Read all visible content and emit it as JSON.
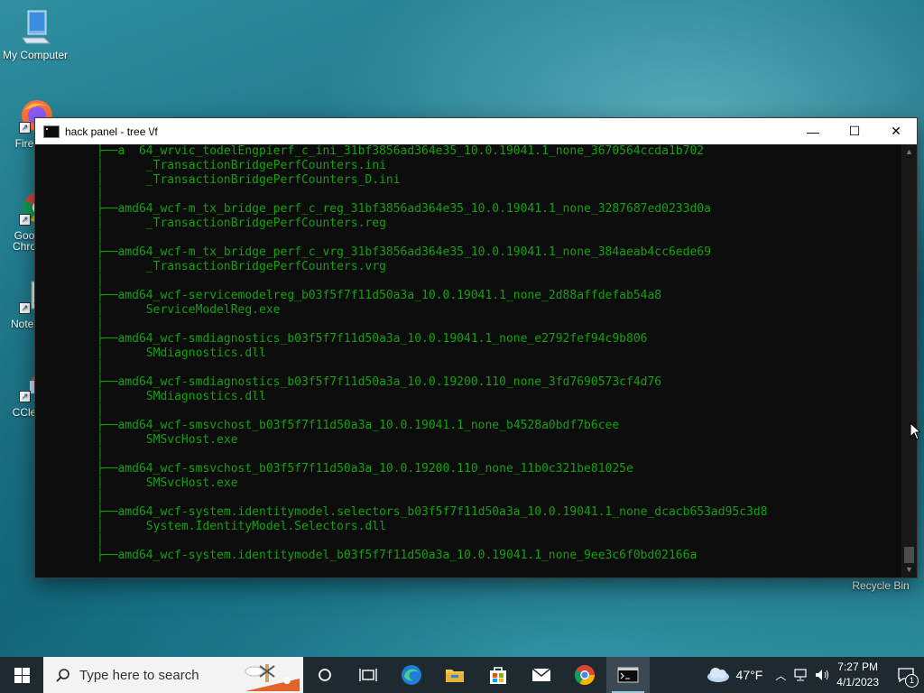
{
  "desktop": {
    "icons": [
      {
        "label": "My Computer"
      },
      {
        "label": "Fire"
      },
      {
        "label": "Goo"
      },
      {
        "label": "Chro"
      },
      {
        "label": "Notep"
      },
      {
        "label": "CCle"
      },
      {
        "label": "Recycle Bin"
      }
    ]
  },
  "console_window": {
    "title": "hack panel  - tree  \\/f",
    "minimize": "—",
    "maximize": "☐",
    "close": "✕",
    "lines": [
      "├──a  64_wrvic_todelEngpierf_c_ini_31bf3856ad364e35_10.0.19041.1_none_3670564ccda1b702",
      "│      _TransactionBridgePerfCounters.ini",
      "│      _TransactionBridgePerfCounters_D.ini",
      "│",
      "├──amd64_wcf-m_tx_bridge_perf_c_reg_31bf3856ad364e35_10.0.19041.1_none_3287687ed0233d0a",
      "│      _TransactionBridgePerfCounters.reg",
      "│",
      "├──amd64_wcf-m_tx_bridge_perf_c_vrg_31bf3856ad364e35_10.0.19041.1_none_384aeab4cc6ede69",
      "│      _TransactionBridgePerfCounters.vrg",
      "│",
      "├──amd64_wcf-servicemodelreg_b03f5f7f11d50a3a_10.0.19041.1_none_2d88affdefab54a8",
      "│      ServiceModelReg.exe",
      "│",
      "├──amd64_wcf-smdiagnostics_b03f5f7f11d50a3a_10.0.19041.1_none_e2792fef94c9b806",
      "│      SMdiagnostics.dll",
      "│",
      "├──amd64_wcf-smdiagnostics_b03f5f7f11d50a3a_10.0.19200.110_none_3fd7690573cf4d76",
      "│      SMdiagnostics.dll",
      "│",
      "├──amd64_wcf-smsvchost_b03f5f7f11d50a3a_10.0.19041.1_none_b4528a0bdf7b6cee",
      "│      SMSvcHost.exe",
      "│",
      "├──amd64_wcf-smsvchost_b03f5f7f11d50a3a_10.0.19200.110_none_11b0c321be81025e",
      "│      SMSvcHost.exe",
      "│",
      "├──amd64_wcf-system.identitymodel.selectors_b03f5f7f11d50a3a_10.0.19041.1_none_dcacb653ad95c3d8",
      "│      System.IdentityModel.Selectors.dll",
      "│",
      "├──amd64_wcf-system.identitymodel_b03f5f7f11d50a3a_10.0.19041.1_none_9ee3c6f0bd02166a"
    ]
  },
  "taskbar": {
    "search_placeholder": "Type here to search",
    "weather_temp": "47°F",
    "time": "7:27 PM",
    "date": "4/1/2023",
    "notification_count": "1"
  },
  "colors": {
    "console_text": "#13a10e",
    "console_bg": "#0c0c0c",
    "taskbar_bg": "#1f2a30"
  }
}
